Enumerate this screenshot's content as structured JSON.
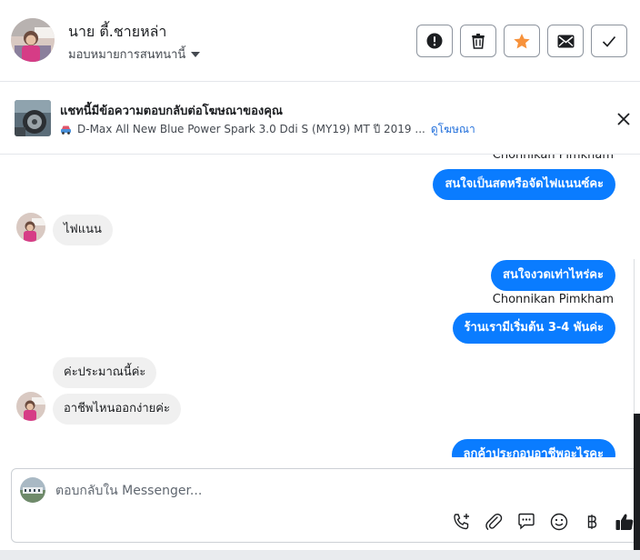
{
  "header": {
    "name": "นาย ตี้.ชายหล่า",
    "assign_label": "มอบหมายการสนทนานี้"
  },
  "ad": {
    "title": "แชทนี้มีข้อความตอบกลับต่อโฆษณาของคุณ",
    "product": "D-Max All New Blue Power Spark 3.0 Ddi S (MY19) MT ปี 2019 ...",
    "view_ad": "ดูโฆษณา"
  },
  "messages": [
    {
      "id": "m0",
      "direction": "sender",
      "text": "Chonnikan Pimkham"
    },
    {
      "id": "m1",
      "direction": "out",
      "text": "สนใจเป็นสดหรือจัดไฟแนนซ์คะ"
    },
    {
      "id": "m2",
      "direction": "in",
      "text": "ไฟแนน"
    },
    {
      "id": "m3",
      "direction": "out",
      "text": "สนใจงวดเท่าไหร่คะ"
    },
    {
      "id": "m4",
      "direction": "sender",
      "text": "Chonnikan Pimkham"
    },
    {
      "id": "m5",
      "direction": "out",
      "text": "ร้านเรามีเริ่มต้น 3-4 พันค่ะ"
    },
    {
      "id": "m6",
      "direction": "in",
      "text": "ค่ะประมาณนี้ค่ะ"
    },
    {
      "id": "m7",
      "direction": "in",
      "text": "อาชีพไหนออกง่ายค่ะ"
    },
    {
      "id": "m8",
      "direction": "out",
      "text": "ลูกค้าประกอบอาชีพอะไรคะ"
    }
  ],
  "composer": {
    "placeholder": "ตอบกลับใน Messenger..."
  },
  "icons": {
    "report": "exclamation-circle-icon",
    "delete": "trash-icon",
    "star": "star-icon",
    "mail": "envelope-icon",
    "done": "checkmark-icon",
    "close": "close-icon",
    "call": "phone-plus-icon",
    "attach": "paperclip-icon",
    "saved_reply": "chat-bubble-icon",
    "emoji": "smiley-icon",
    "payment": "baht-icon",
    "like": "thumbs-up-icon"
  },
  "colors": {
    "accent": "#0a7cff",
    "star": "#f7923b",
    "link": "#216fdb"
  }
}
